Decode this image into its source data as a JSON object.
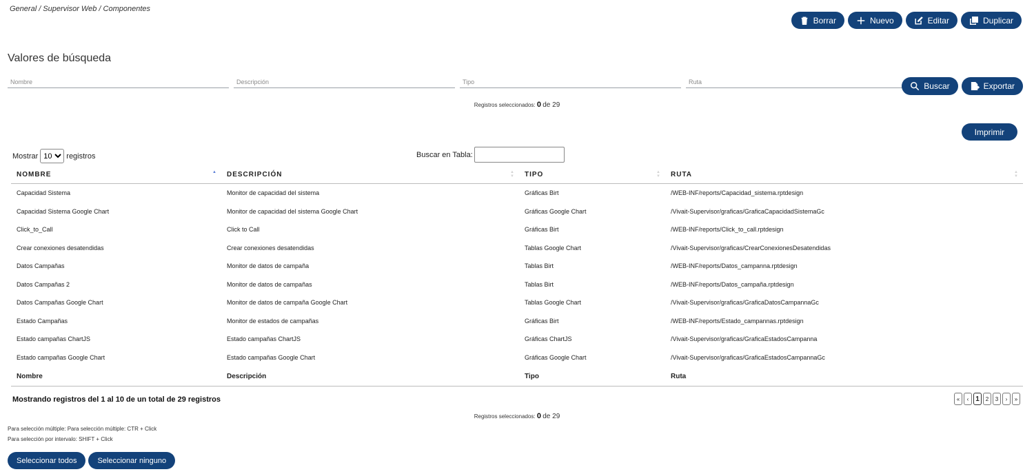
{
  "breadcrumb": "General / Supervisor Web / Componentes",
  "toolbar": {
    "delete_label": "Borrar",
    "new_label": "Nuevo",
    "edit_label": "Editar",
    "duplicate_label": "Duplicar"
  },
  "search": {
    "title": "Valores de búsqueda",
    "name_placeholder": "Nombre",
    "description_placeholder": "Descripción",
    "type_placeholder": "Tipo",
    "path_placeholder": "Ruta",
    "search_label": "Buscar",
    "export_label": "Exportar"
  },
  "selection": {
    "label": "Registros seleccionados:",
    "count": "0",
    "total": "de 29"
  },
  "print_label": "Imprimir",
  "table_controls": {
    "show_label": "Mostrar",
    "page_size": "10",
    "records_label": "registros",
    "table_search_label": "Buscar en Tabla:"
  },
  "table": {
    "headers": [
      "NOMBRE",
      "DESCRIPCIÓN",
      "TIPO",
      "RUTA"
    ],
    "footers": [
      "Nombre",
      "Descripción",
      "Tipo",
      "Ruta"
    ],
    "rows": [
      [
        "Capacidad Sistema",
        "Monitor de capacidad del sistema",
        "Gráficas Birt",
        "/WEB-INF/reports/Capacidad_sistema.rptdesign"
      ],
      [
        "Capacidad Sistema Google Chart",
        "Monitor de capacidad del sistema Google Chart",
        "Gráficas Google Chart",
        "/Vivait-Supervisor/graficas/GraficaCapacidadSistemaGc"
      ],
      [
        "Click_to_Call",
        "Click to Call",
        "Gráficas Birt",
        "/WEB-INF/reports/Click_to_call.rptdesign"
      ],
      [
        "Crear conexiones desatendidas",
        "Crear conexiones desatendidas",
        "Tablas Google Chart",
        "/Vivait-Supervisor/graficas/CrearConexionesDesatendidas"
      ],
      [
        "Datos Campañas",
        "Monitor de datos de campaña",
        "Tablas Birt",
        "/WEB-INF/reports/Datos_campanna.rptdesign"
      ],
      [
        "Datos Campañas 2",
        "Monitor de datos de campañas",
        "Tablas Birt",
        "/WEB-INF/reports/Datos_campaña.rptdesign"
      ],
      [
        "Datos Campañas Google Chart",
        "Monitor de datos de campaña Google Chart",
        "Tablas Google Chart",
        "/Vivait-Supervisor/graficas/GraficaDatosCampannaGc"
      ],
      [
        "Estado Campañas",
        "Monitor de estados de campañas",
        "Gráficas Birt",
        "/WEB-INF/reports/Estado_campannas.rptdesign"
      ],
      [
        "Estado campañas ChartJS",
        "Estado campañas ChartJS",
        "Gráficas ChartJS",
        "/Vivait-Supervisor/graficas/GraficaEstadosCampanna"
      ],
      [
        "Estado campañas Google Chart",
        "Estado campañas Google Chart",
        "Gráficas Google Chart",
        "/Vivait-Supervisor/graficas/GraficaEstadosCampannaGc"
      ]
    ]
  },
  "info": "Mostrando registros del 1 al 10 de un total de 29 registros",
  "pagination": {
    "first": "«",
    "prev": "‹",
    "pages": [
      "1",
      "2",
      "3"
    ],
    "next": "›",
    "last": "»"
  },
  "help": {
    "multi": "Para selección múltiple: Para selección múltiple: CTR + Click",
    "range": "Para selección por intervalo: SHIFT + Click"
  },
  "bottom": {
    "select_all": "Seleccionar todos",
    "select_none": "Seleccionar ninguno"
  }
}
